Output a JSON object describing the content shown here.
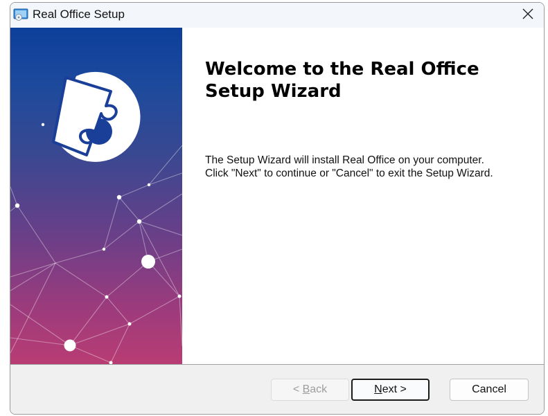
{
  "window": {
    "title": "Real Office Setup",
    "app_icon": "installer-disc-icon",
    "close_icon": "close-icon"
  },
  "content": {
    "heading": "Welcome to the Real Office Setup Wizard",
    "description_line1": "The Setup Wizard will install Real Office on your computer.",
    "description_line2": "Click \"Next\" to continue or \"Cancel\" to exit the Setup Wizard."
  },
  "buttons": {
    "back": {
      "prefix": "< ",
      "accel": "B",
      "rest": "ack",
      "enabled": false
    },
    "next": {
      "accel": "N",
      "rest": "ext >",
      "default": true
    },
    "cancel": {
      "label": "Cancel"
    }
  },
  "banner": {
    "logo": "puzzle-disc-logo",
    "colors": {
      "top": "#0c3f9a",
      "bottom": "#b93c73"
    }
  }
}
